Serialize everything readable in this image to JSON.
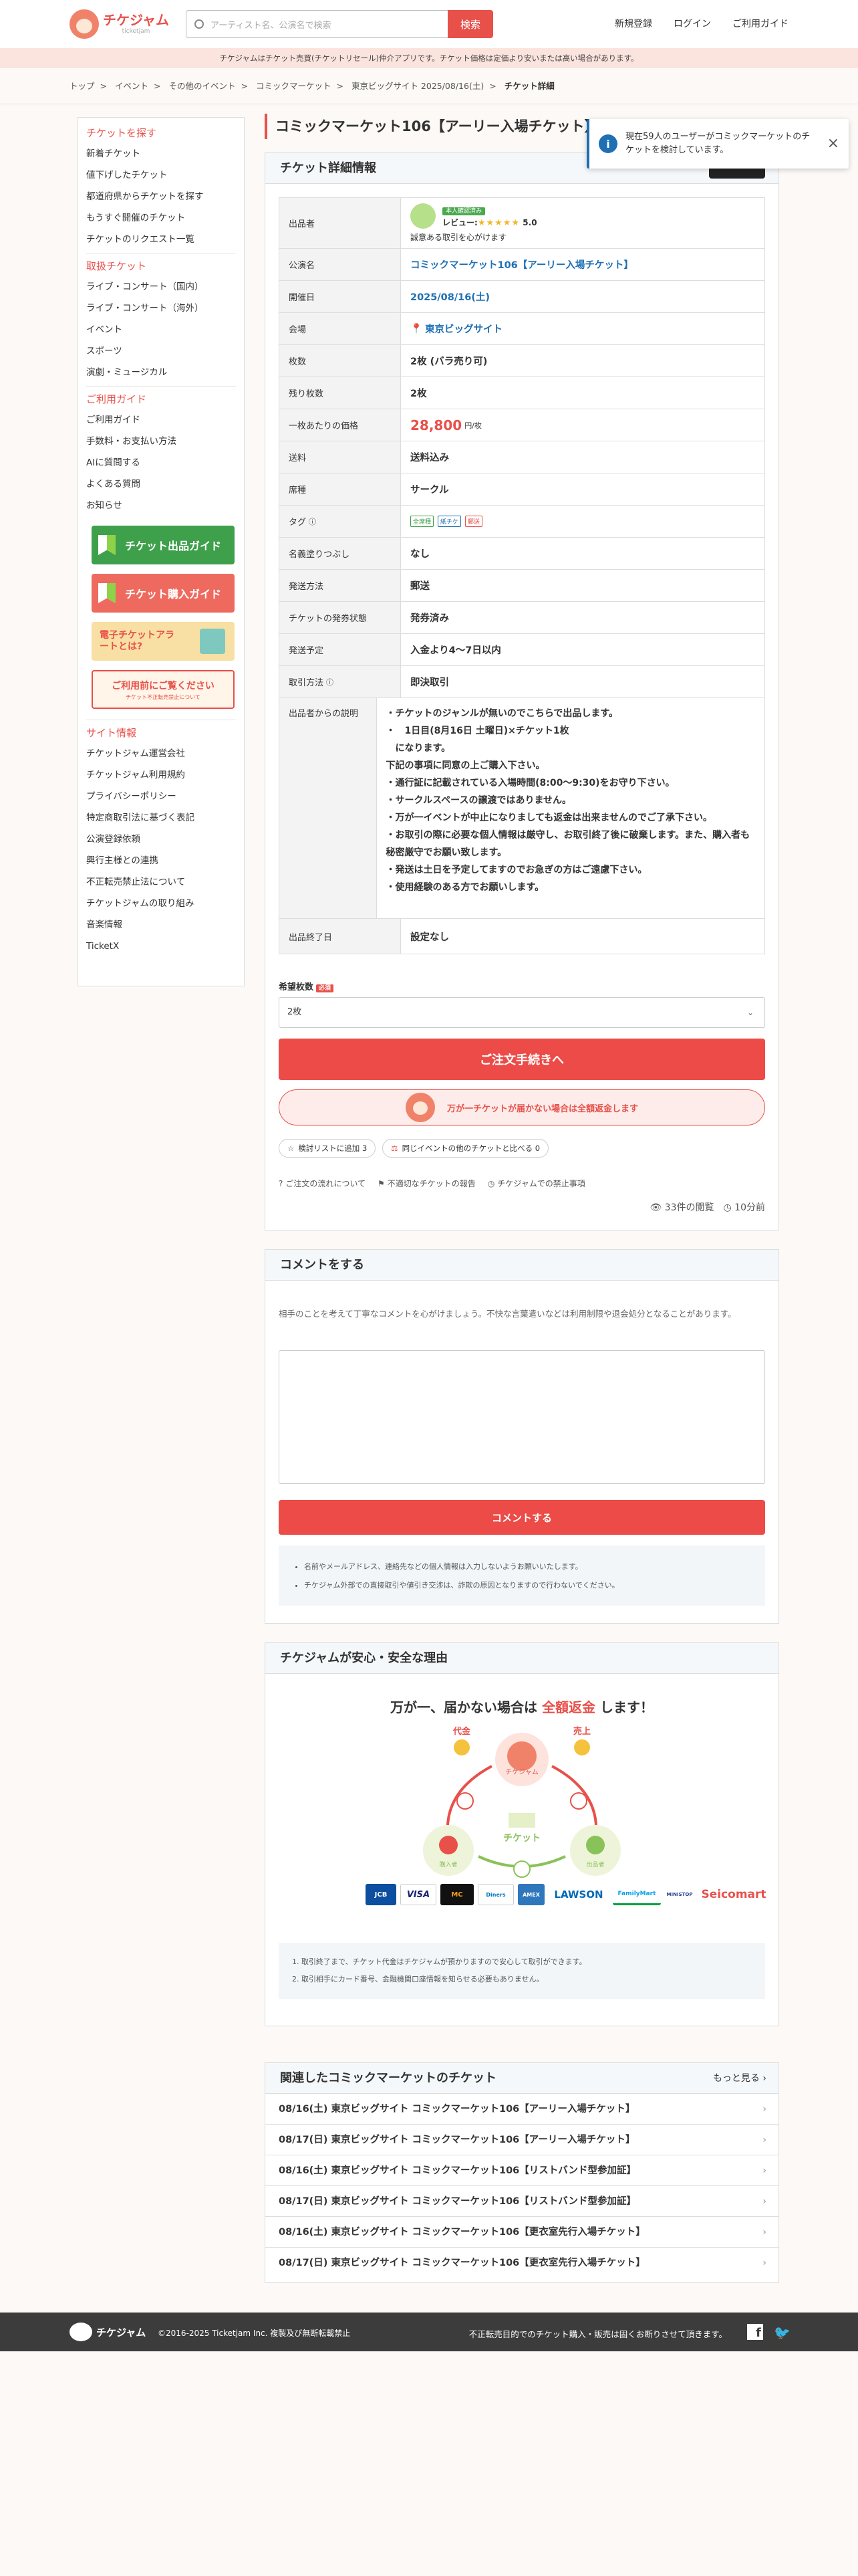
{
  "header": {
    "logo_text": "チケジャム",
    "logo_sub": "ticketjam",
    "search_placeholder": "アーティスト名、公演名で検索",
    "search_button": "検索",
    "nav": [
      "新規登録",
      "ログイン",
      "ご利用ガイド"
    ]
  },
  "notice": "チケジャムはチケット売買(チケットリセール)仲介アプリです。チケット価格は定価より安いまたは高い場合があります。",
  "breadcrumb": [
    "トップ",
    "イベント",
    "その他のイベント",
    "コミックマーケット",
    "東京ビッグサイト 2025/08/16(土)",
    "チケット詳細"
  ],
  "sidebar": {
    "sections": [
      {
        "title": "チケットを探す",
        "items": [
          "新着チケット",
          "値下げしたチケット",
          "都道府県からチケットを探す",
          "もうすぐ開催のチケット",
          "チケットのリクエスト一覧"
        ]
      },
      {
        "title": "取扱チケット",
        "items": [
          "ライブ・コンサート（国内）",
          "ライブ・コンサート（海外）",
          "イベント",
          "スポーツ",
          "演劇・ミュージカル"
        ]
      },
      {
        "title": "ご利用ガイド",
        "items": [
          "ご利用ガイド",
          "手数料・お支払い方法",
          "AIに質問する",
          "よくある質問",
          "お知らせ"
        ]
      }
    ],
    "banners": [
      "チケット出品ガイド",
      "チケット購入ガイド",
      "電子チケットアラートとは?",
      "ご利用前にご覧ください",
      "チケット不正転売禁止について"
    ],
    "site_title": "サイト情報",
    "site_items": [
      "チケットジャム運営会社",
      "チケットジャム利用規約",
      "プライバシーポリシー",
      "特定商取引法に基づく表記",
      "公演登録依頼",
      "興行主様との連携",
      "不正転売禁止法について",
      "チケットジャムの取り組み",
      "音楽情報",
      "TicketX"
    ]
  },
  "page_title": "コミックマーケット106【アーリー入場チケット】 チケット",
  "toast": {
    "text": "現在59人のユーザーがコミックマーケットのチケットを検討しています。",
    "close": "×"
  },
  "detail": {
    "heading": "チケット詳細情報",
    "labels": {
      "seller": "出品者",
      "event": "公演名",
      "date": "開催日",
      "venue": "会場",
      "count": "枚数",
      "remaining": "残り枚数",
      "unit_price": "一枚あたりの価格",
      "shipping": "送料",
      "seat": "席種",
      "tags": "タグ",
      "name_hidden": "名義塗りつぶし",
      "delivery": "発送方法",
      "issue_status": "チケットの発券状態",
      "ship_plan": "発送予定",
      "trade_method": "取引方法",
      "seller_note": "出品者からの説明",
      "end_date": "出品終了日"
    },
    "seller_badge": "本人確認済み",
    "seller_review_label": "レビュー:",
    "stars": "★★★★★",
    "rating": "5.0",
    "seller_comment": "誠意ある取引を心がけます",
    "event": "コミックマーケット106【アーリー入場チケット】",
    "date": "2025/08/16(土)",
    "venue": "東京ビッグサイト",
    "count": "2枚 (バラ売り可)",
    "remaining": "2枚",
    "price": "28,800",
    "price_unit": "円/枚",
    "shipping": "送料込み",
    "seat": "サークル",
    "tags": [
      "全席種",
      "紙チケ",
      "郵送"
    ],
    "name_hidden": "なし",
    "delivery": "郵送",
    "issue_status": "発券済み",
    "ship_plan": "入金より4〜7日以内",
    "trade_method": "即決取引",
    "note_lines": [
      "・チケットのジャンルが無いのでこちらで出品します。",
      "・　1日目(8月16日 土曜日)×チケット1枚",
      "　になります。",
      "下記の事項に同意の上ご購入下さい。",
      "・通行証に記載されている入場時間(8:00〜9:30)をお守り下さい。",
      "・サークルスペースの譲渡ではありません。",
      "・万が一イベントが中止になりましても返金は出来ませんのでご了承下さい。",
      "・お取引の際に必要な個人情報は厳守し、お取引終了後に破棄します。また、購入者も秘密厳守でお願い致します。",
      "・発送は土日を予定してますのでお急ぎの方はご遠慮下さい。",
      "・使用経験のある方でお願いします。"
    ],
    "end_date": "設定なし",
    "qty_label": "希望枚数",
    "qty_required": "必須",
    "qty_value": "2枚",
    "order_button": "ご注文手続きへ",
    "guarantee": "万が一チケットが届かない場合は全額返金します",
    "pill_fav": "検討リストに追加 3",
    "pill_compare": "同じイベントの他のチケットと比べる 0",
    "link_flow": "ご注文の流れについて",
    "link_report": "不適切なチケットの報告",
    "link_ban": "チケジャムでの禁止事項",
    "views": "33件の閲覧",
    "time_ago": "10分前"
  },
  "comment": {
    "heading": "コメントをする",
    "guide": "相手のことを考えて丁寧なコメントを心がけましょう。不快な言葉遣いなどは利用制限や退会処分となることがあります。",
    "button": "コメントする",
    "notes": [
      "名前やメールアドレス、連絡先などの個人情報は入力しないようお願いいたします。",
      "チケジャム外部での直接取引や値引き交渉は、詐欺の原因となりますので行わないでください。"
    ]
  },
  "safety": {
    "heading": "チケジャムが安心・安全な理由",
    "title_pre": "万が一、届かない場合は",
    "title_red": "全額返金",
    "title_post": "します！",
    "flow_labels": [
      "代金",
      "売上",
      "チケジャム",
      "チケット",
      "購入者",
      "出品者"
    ],
    "payments": [
      "JCB",
      "VISA",
      "MC",
      "Diners",
      "AMEX",
      "LAWSON",
      "FamilyMart",
      "MINISTOP",
      "Seicomart"
    ],
    "notes": [
      "取引終了まで、チケット代金はチケジャムが預かりますので安心して取引ができます。",
      "取引相手にカード番号、金融機関口座情報を知らせる必要もありません。"
    ]
  },
  "related": {
    "heading": "関連したコミックマーケットのチケット",
    "more": "もっと見る",
    "items": [
      "08/16(土) 東京ビッグサイト コミックマーケット106【アーリー入場チケット】",
      "08/17(日) 東京ビッグサイト コミックマーケット106【アーリー入場チケット】",
      "08/16(土) 東京ビッグサイト コミックマーケット106【リストバンド型参加証】",
      "08/17(日) 東京ビッグサイト コミックマーケット106【リストバンド型参加証】",
      "08/16(土) 東京ビッグサイト コミックマーケット106【更衣室先行入場チケット】",
      "08/17(日) 東京ビッグサイト コミックマーケット106【更衣室先行入場チケット】"
    ]
  },
  "footer": {
    "logo": "チケジャム",
    "copyright": "©2016-2025 Ticketjam Inc. 複製及び無断転載禁止",
    "right": "不正転売目的でのチケット購入・販売は固くお断りさせて頂きます。"
  },
  "colors": {
    "accent": "#e8504a",
    "link": "#1e6fb3",
    "green": "#3ea04b"
  }
}
